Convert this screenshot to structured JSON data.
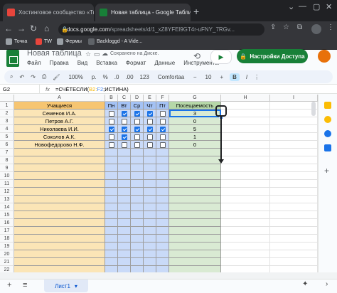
{
  "browser": {
    "tabs": [
      {
        "label": "Хостинговое сообщество «Тим»",
        "fav_color": "#e8453c"
      },
      {
        "label": "Новая таблица - Google Табли",
        "fav_color": "#188038"
      }
    ],
    "new_tab": "+",
    "url_domain": "docs.google.com",
    "url_path": "/spreadsheets/d/1_xZ8YFEl9GT4r-uFNY_7RGv...",
    "bookmarks": [
      {
        "label": "Точка",
        "color": "#9aa0a6"
      },
      {
        "label": "TW",
        "color": "#e8453c"
      },
      {
        "label": "Фермы",
        "color": "#9aa0a6"
      },
      {
        "label": "Backloggd - A Vide...",
        "color": "#5f6368"
      }
    ]
  },
  "sheets": {
    "doc_title": "Новая таблица",
    "saved_status": "Сохранено на Диске.",
    "menu": [
      "Файл",
      "Правка",
      "Вид",
      "Вставка",
      "Формат",
      "Данные",
      "Инструменты"
    ],
    "share_label": "Настройки Доступа",
    "toolbar": {
      "zoom": "100%",
      "currency": "р.",
      "percent": "%",
      "dec1": ".0",
      "dec2": ".00",
      "numfmt": "123",
      "font": "Comfortaa",
      "size": "10",
      "bold": "B"
    },
    "cell_ref": "G2",
    "formula_prefix": "=СЧЁТЕСЛИ(",
    "formula_r1": "B2",
    "formula_sep": ":",
    "formula_r2": "F2",
    "formula_suffix": ";ИСТИНА)",
    "columns": [
      "A",
      "B",
      "C",
      "D",
      "E",
      "F",
      "G",
      "H",
      "I"
    ],
    "rows": [
      "1",
      "2",
      "3",
      "4",
      "5",
      "6",
      "7",
      "8",
      "9",
      "10",
      "11",
      "12",
      "13",
      "14",
      "15",
      "16",
      "17",
      "18",
      "19",
      "20",
      "21",
      "22"
    ],
    "header_row": {
      "a": "Учащиеся",
      "b": "Пн",
      "c": "Вт",
      "d": "Ср",
      "e": "Чт",
      "f": "Пт",
      "g": "Посещаемость"
    },
    "students": [
      {
        "name": "Семенов И.А.",
        "checks": [
          false,
          true,
          true,
          true,
          false
        ],
        "count": "3"
      },
      {
        "name": "Петров А.Г.",
        "checks": [
          false,
          false,
          false,
          false,
          false
        ],
        "count": "0"
      },
      {
        "name": "Николаева И.И.",
        "checks": [
          true,
          true,
          true,
          true,
          true
        ],
        "count": "5"
      },
      {
        "name": "Соколов А.К.",
        "checks": [
          false,
          true,
          false,
          false,
          false
        ],
        "count": "1"
      },
      {
        "name": "Новофедорово Н.Ф.",
        "checks": [
          false,
          false,
          false,
          false,
          false
        ],
        "count": "0"
      }
    ],
    "sheet_tab": "Лист1",
    "colors": {
      "names": "#fbe5b6",
      "days": "#c9daf8",
      "attendance": "#d9ead3",
      "header_names": "#f6c571",
      "header_days": "#a4c2f4",
      "header_att": "#b6d7a8"
    }
  }
}
